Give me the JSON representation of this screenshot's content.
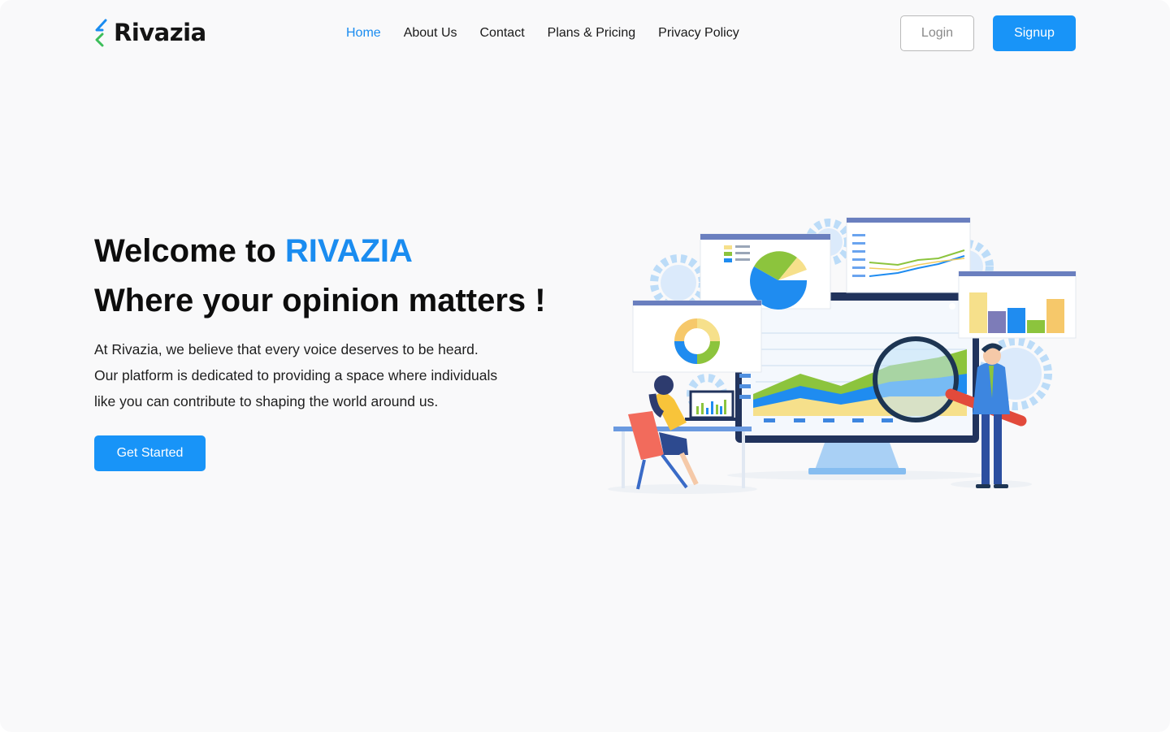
{
  "brand": {
    "name": "Rivazia",
    "colors": {
      "accent": "#1894F8",
      "logo_blue": "#1A8CF0",
      "logo_green": "#3DBE5A"
    }
  },
  "nav": {
    "items": [
      {
        "label": "Home",
        "active": true
      },
      {
        "label": "About Us",
        "active": false
      },
      {
        "label": "Contact",
        "active": false
      },
      {
        "label": "Plans & Pricing",
        "active": false
      },
      {
        "label": "Privacy Policy",
        "active": false
      }
    ]
  },
  "auth": {
    "login_label": "Login",
    "signup_label": "Signup"
  },
  "hero": {
    "title_prefix": "Welcome to ",
    "title_brand": "RIVAZIA",
    "subtitle": "Where your opinion matters !",
    "body_lines": [
      "At Rivazia, we believe that every voice deserves to be heard.",
      "Our platform is dedicated to providing a space where individuals",
      "like you can contribute to shaping the world around us."
    ],
    "cta_label": "Get Started"
  },
  "illustration": {
    "icon": "data-analytics-illustration"
  }
}
